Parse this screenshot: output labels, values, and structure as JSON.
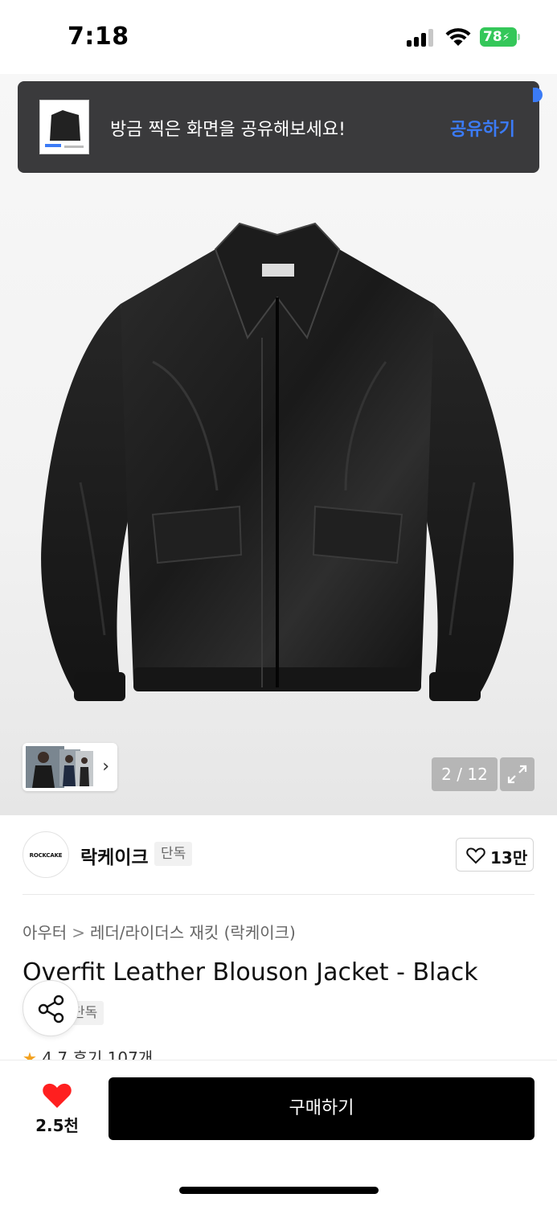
{
  "status_bar": {
    "time": "7:18",
    "battery": "78"
  },
  "toast": {
    "message": "방금 찍은 화면을 공유해보세요!",
    "action": "공유하기"
  },
  "gallery": {
    "counter": "2 / 12"
  },
  "brand": {
    "logo_text": "ROCKCAKE",
    "name": "락케이크",
    "badge": "단독",
    "like_count": "13만"
  },
  "breadcrumb": {
    "category": "아우터",
    "separator": ">",
    "subcategory": "레더/라이더스 재킷 (락케이크)"
  },
  "product": {
    "title": "Overfit Leather Blouson Jacket - Black",
    "badge": "단독",
    "rating": "4.7",
    "review_label": "후기 107개"
  },
  "bottom_bar": {
    "wish_count": "2.5천",
    "buy_label": "구매하기"
  },
  "colors": {
    "accent_blue": "#3b7bf6",
    "heart_red": "#ff1f1f",
    "battery_green": "#34c759",
    "star_orange": "#f3a11f"
  }
}
